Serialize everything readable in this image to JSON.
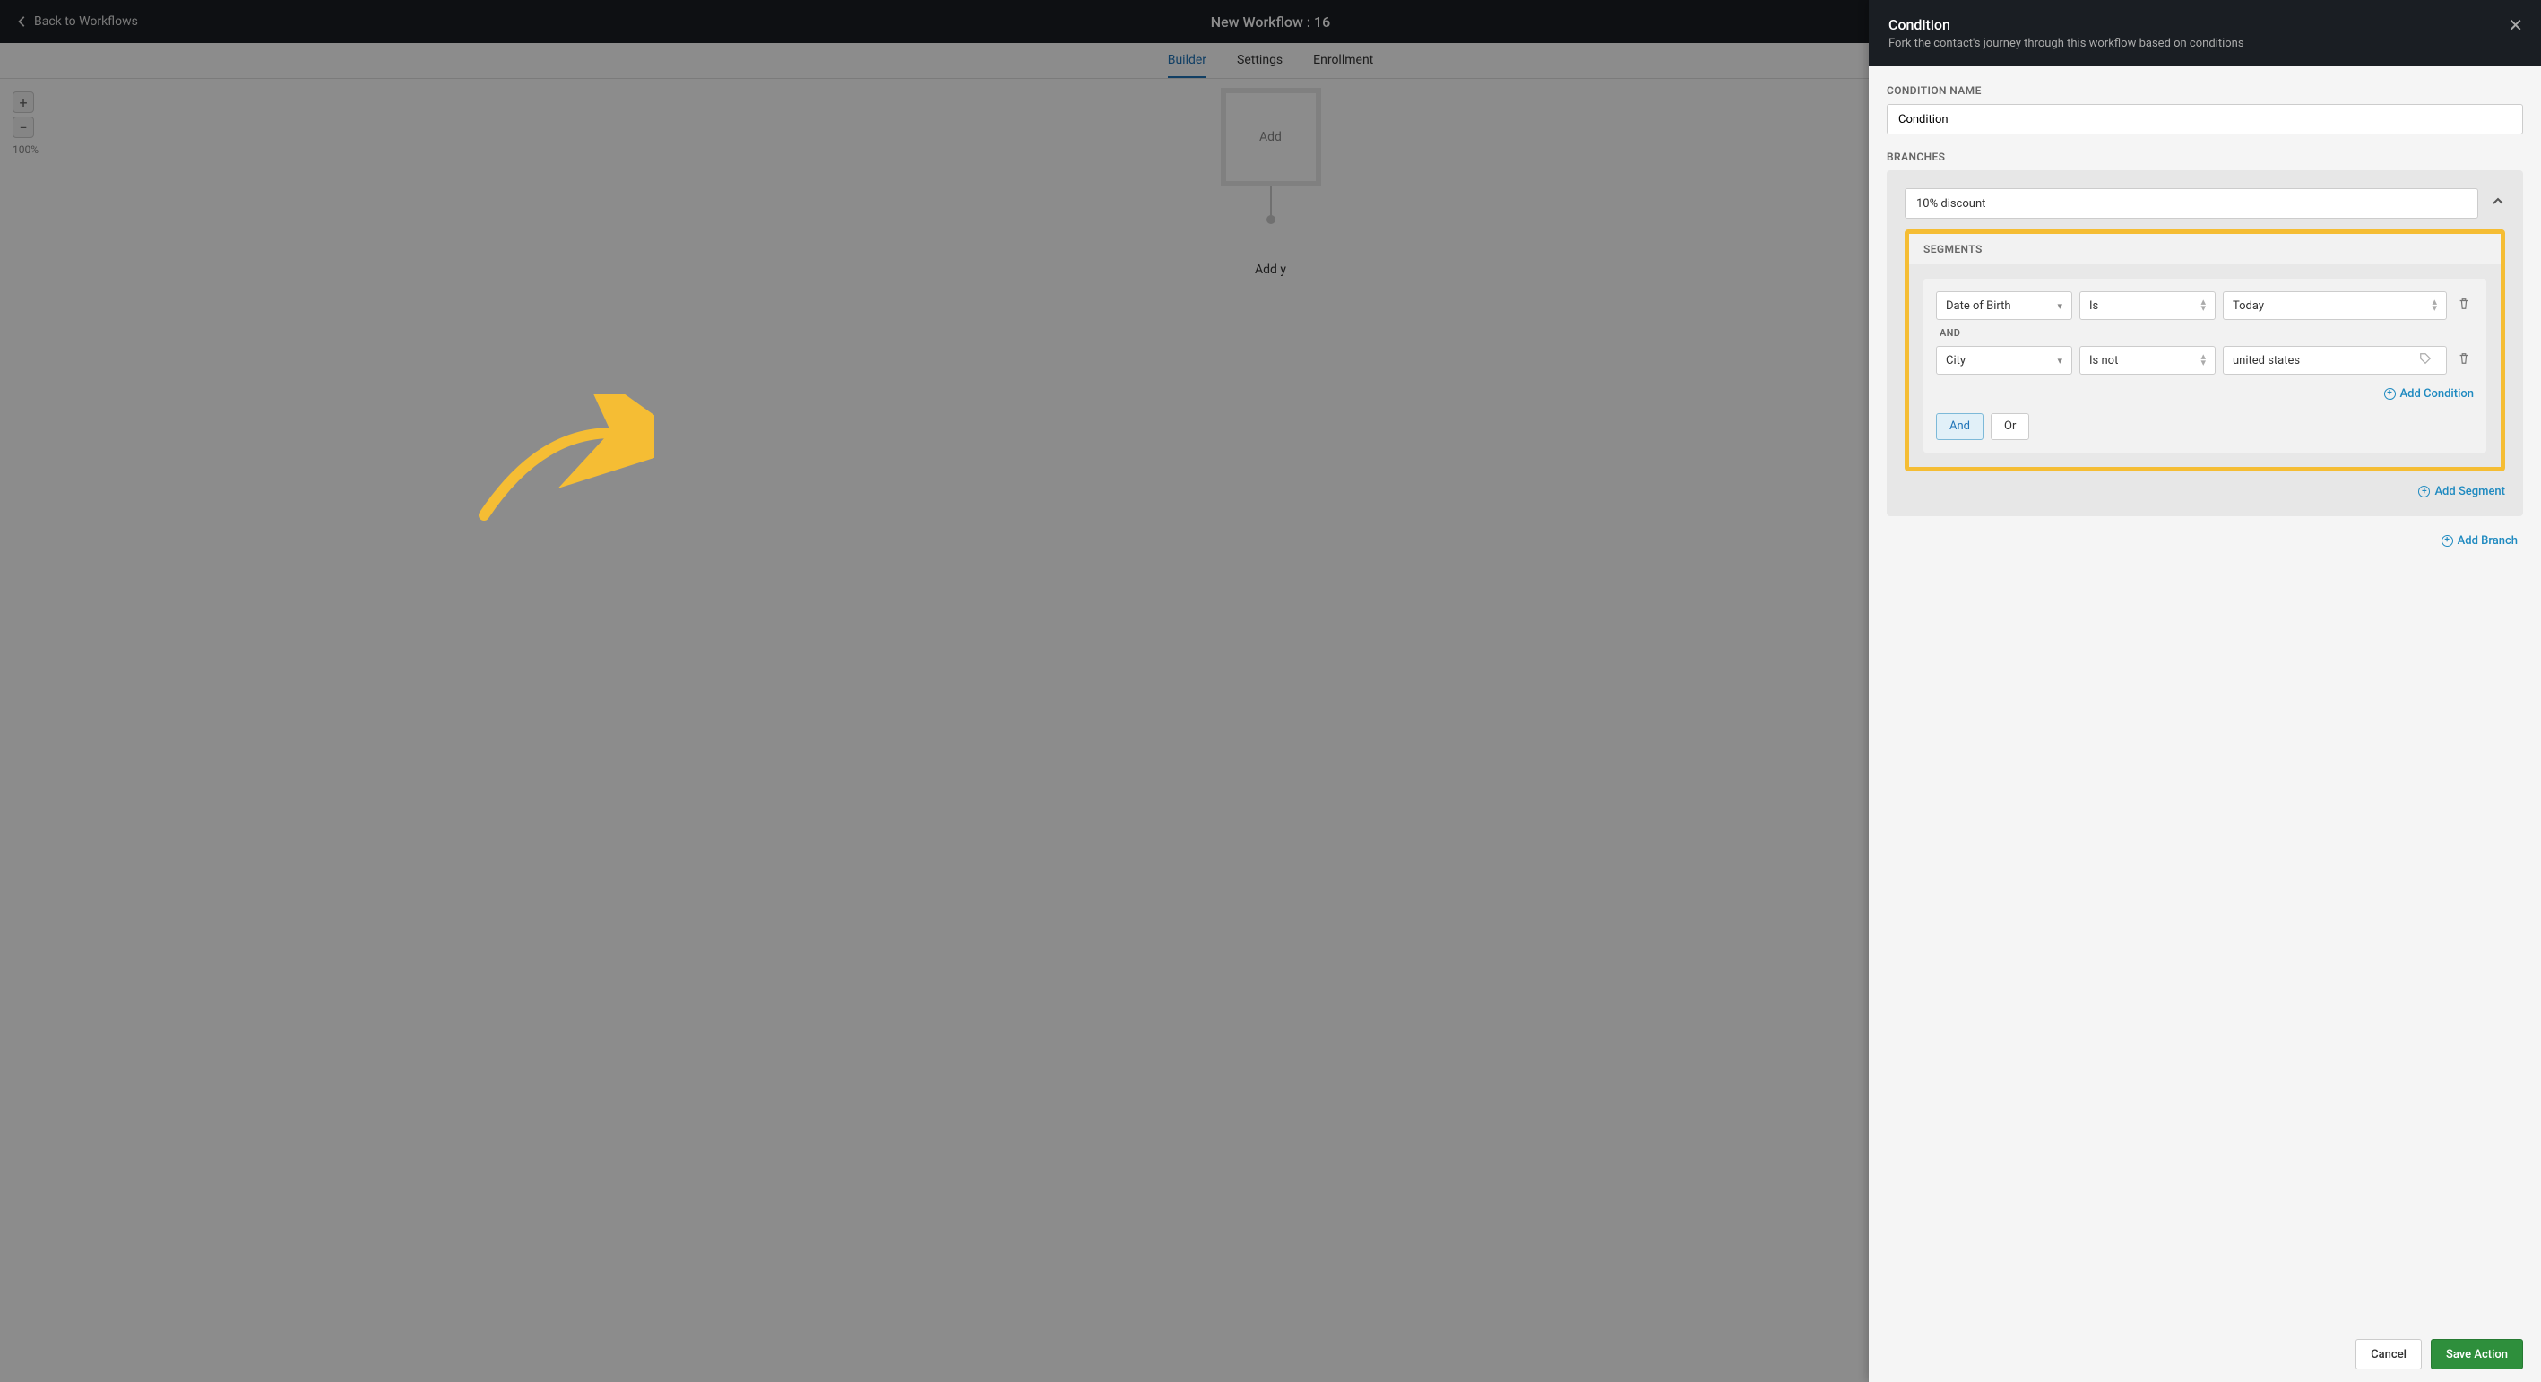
{
  "topbar": {
    "back_label": "Back to Workflows",
    "title": "New Workflow : 16"
  },
  "tabs": {
    "builder": "Builder",
    "settings": "Settings",
    "enrollment": "Enrollment"
  },
  "canvas": {
    "zoom_label": "100%",
    "start_card": "Add",
    "add_action": "Add y"
  },
  "panel": {
    "title": "Condition",
    "subtitle": "Fork the contact's journey through this workflow based on conditions"
  },
  "condition_name": {
    "label": "Condition Name",
    "value": "Condition"
  },
  "branches_label": "Branches",
  "branch": {
    "name": "10% discount"
  },
  "segments": {
    "label": "Segments",
    "rules": [
      {
        "field": "Date of Birth",
        "op": "Is",
        "value": "Today"
      },
      {
        "field": "City",
        "op": "Is not",
        "value": "united states"
      }
    ],
    "and_divider": "AND",
    "add_condition": "Add Condition",
    "and": "And",
    "or": "Or"
  },
  "add_segment": "Add Segment",
  "add_branch": "Add Branch",
  "footer": {
    "cancel": "Cancel",
    "save": "Save Action"
  }
}
